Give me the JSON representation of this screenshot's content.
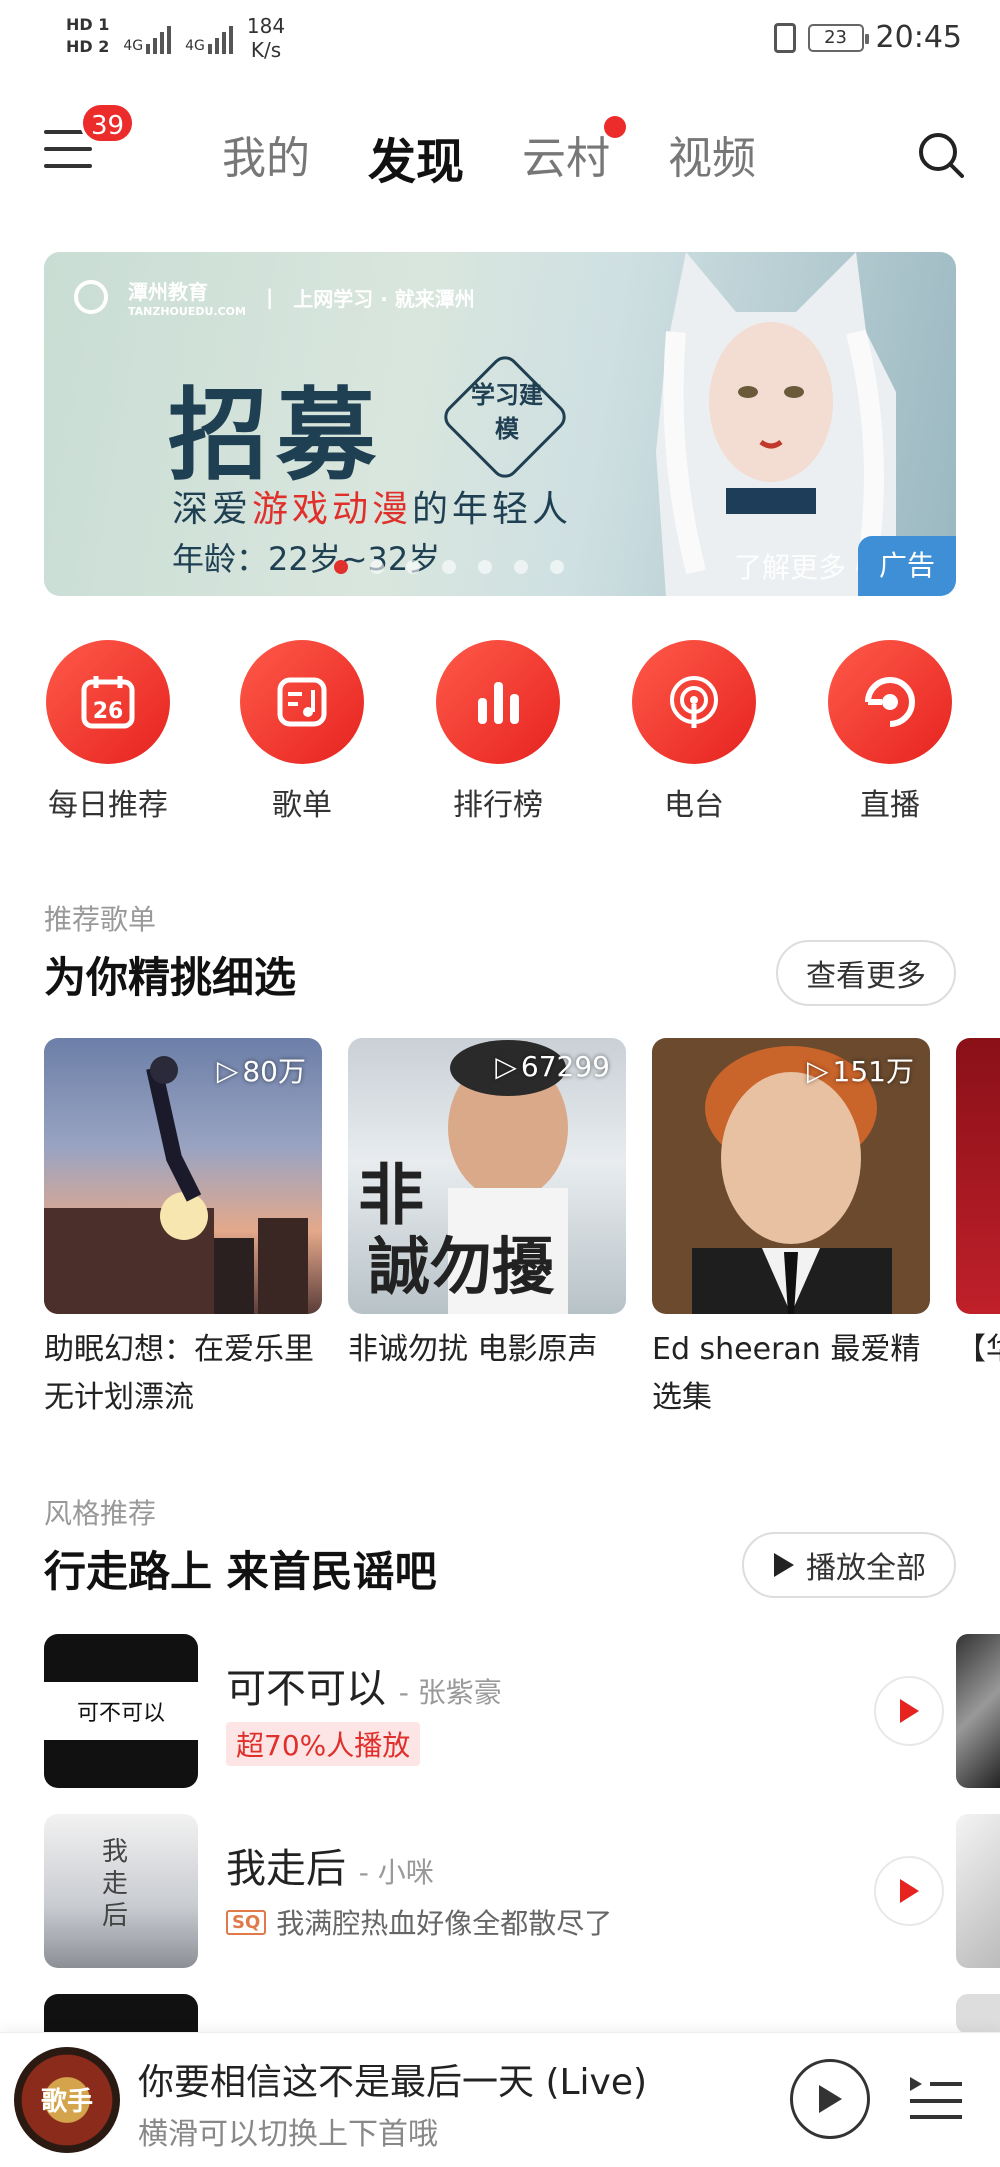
{
  "status": {
    "hd1": "HD 1",
    "hd2": "HD 2",
    "net1": "4G",
    "net2": "4G",
    "speed_value": "184",
    "speed_unit": "K/s",
    "battery": "23",
    "time": "20:45"
  },
  "nav": {
    "menu_badge": "39",
    "tabs": [
      {
        "label": "我的",
        "active": false
      },
      {
        "label": "发现",
        "active": true
      },
      {
        "label": "云村",
        "active": false,
        "dot": true
      },
      {
        "label": "视频",
        "active": false
      }
    ]
  },
  "banner": {
    "brand": "潭州教育",
    "brand_sub": "TANZHOUEDU.COM",
    "slogan": "上网学习 · 就来潭州",
    "headline": "招募",
    "hex_text": "学习建模",
    "line1_a": "深爱",
    "line1_hl": "游戏动漫",
    "line1_b": "的年轻人",
    "line2": "年龄：22岁~32岁",
    "more": "了解更多",
    "ad_label": "广告",
    "slides_total": 7,
    "slide_active": 1
  },
  "quick_actions": [
    {
      "label": "每日推荐",
      "icon": "calendar-icon",
      "day": "26"
    },
    {
      "label": "歌单",
      "icon": "playlist-icon"
    },
    {
      "label": "排行榜",
      "icon": "chart-bars-icon"
    },
    {
      "label": "电台",
      "icon": "radio-icon"
    },
    {
      "label": "直播",
      "icon": "live-icon"
    }
  ],
  "playlists_section": {
    "subtitle": "推荐歌单",
    "title": "为你精挑细选",
    "more_button": "查看更多",
    "items": [
      {
        "plays": "80万",
        "title": "助眠幻想：在爱乐里无计划漂流"
      },
      {
        "plays": "67299",
        "title": "非诚勿扰 电影原声"
      },
      {
        "plays": "151万",
        "title": "Ed sheeran 最爱精选集"
      },
      {
        "plays": "",
        "title": "【华他的"
      }
    ]
  },
  "style_section": {
    "subtitle": "风格推荐",
    "title": "行走路上 来首民谣吧",
    "play_all": "播放全部",
    "songs": [
      {
        "title": "可不可以",
        "artist": "- 张紫豪",
        "tag": "超70%人播放",
        "cover_text": "可不可以"
      },
      {
        "title": "我走后",
        "artist": "- 小咪",
        "quality": "SQ",
        "lyric": "我满腔热血好像全都散尽了",
        "cover_text": "我走后"
      }
    ]
  },
  "player": {
    "title": "你要相信这不是最后一天 (Live)",
    "subtitle": "横滑可以切换上下首哦",
    "cover_text": "歌手"
  },
  "colors": {
    "accent": "#ec2b2b",
    "ad_blue": "#3f8fd6"
  }
}
